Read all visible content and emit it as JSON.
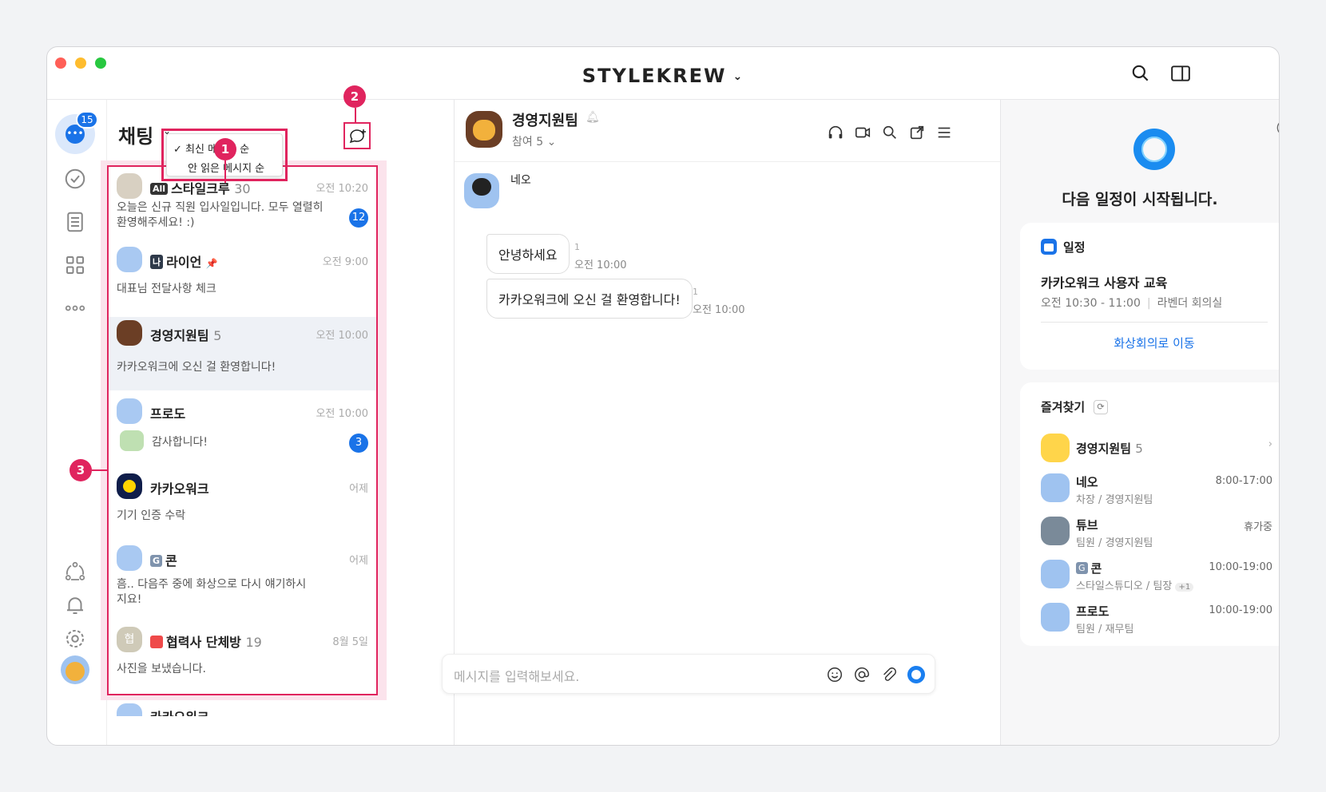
{
  "window": {
    "brand": "STYLEKREW",
    "traffic_colors": [
      "#ff5f57",
      "#febc2e",
      "#28c840"
    ]
  },
  "rail": {
    "chat_badge": "15"
  },
  "list": {
    "title": "채팅",
    "sort_options": [
      {
        "label": "최신 메시지 순",
        "checked": true
      },
      {
        "label": "안 읽은 메시지 순",
        "checked": false
      }
    ],
    "callouts": [
      "1",
      "2",
      "3"
    ],
    "items": [
      {
        "name": "스타일크루",
        "count": "30",
        "tag": "All",
        "time": "오전 10:20",
        "preview": "오늘은 신규 직원 입사일입니다. 모두 열렬히 환영해주세요! :)",
        "badge": "12"
      },
      {
        "name": "라이언",
        "tag": "나",
        "time": "오전 9:00",
        "preview": "대표님 전달사항 체크"
      },
      {
        "name": "경영지원팀",
        "count": "5",
        "time": "오전 10:00",
        "preview": "카카오워크에 오신 걸 환영합니다!"
      },
      {
        "name": "프로도",
        "time": "오전 10:00",
        "preview": "감사합니다!",
        "badge": "3"
      },
      {
        "name": "카카오워크",
        "time": "어제",
        "preview": "기기 인증 수락"
      },
      {
        "name": "콘",
        "tag": "G",
        "time": "어제",
        "preview": "흠.. 다음주 중에 화상으로 다시 얘기하시지요!"
      },
      {
        "name": "협력사 단체방",
        "count": "19",
        "time": "8월 5일",
        "preview": "사진을 보냈습니다.",
        "avatar_text": "협"
      },
      {
        "name": "카카오워크"
      }
    ]
  },
  "chat": {
    "room_name": "경영지원팀",
    "participants": "참여 5",
    "sender": "네오",
    "messages": [
      {
        "text": "안녕하세요",
        "unread": "1",
        "time": "오전 10:00"
      },
      {
        "text": "카카오워크에 오신 걸 환영합니다!",
        "unread": "1",
        "time": "오전 10:00"
      }
    ],
    "input_placeholder": "메시지를 입력해보세요."
  },
  "side": {
    "headline": "다음 일정이 시작됩니다.",
    "schedule_label": "일정",
    "event_title": "카카오워크 사용자 교육",
    "event_time": "오전 10:30 - 11:00",
    "event_place": "라벤더 회의실",
    "video_link": "화상회의로 이동",
    "favorites_title": "즐겨찾기",
    "favorites": [
      {
        "name": "경영지원팀",
        "count": "5"
      },
      {
        "name": "네오",
        "sub": "차장 / 경영지원팀",
        "right": "8:00-17:00"
      },
      {
        "name": "튜브",
        "sub": "팀원 / 경영지원팀",
        "right": "휴가중"
      },
      {
        "name": "콘",
        "tag": "G",
        "sub": "스타일스튜디오 / 팀장",
        "extra": "+1",
        "right": "10:00-19:00"
      },
      {
        "name": "프로도",
        "sub": "팀원 / 재무팀",
        "right": "10:00-19:00"
      }
    ]
  }
}
